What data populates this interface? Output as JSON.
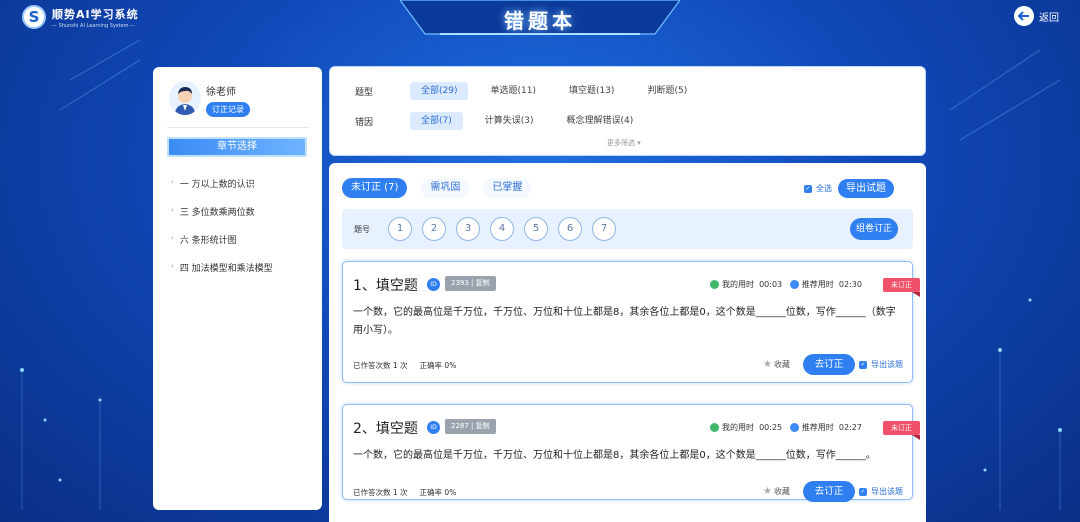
{
  "header": {
    "logo_letter": "S",
    "app_name": "顺势AI学习系统",
    "app_subtitle": "— Shunshi AI Learning System —",
    "page_title": "错题本",
    "back_label": "返回"
  },
  "teacher": {
    "name": "徐老师",
    "record_button": "订正记录"
  },
  "sidebar": {
    "chapter_button": "章节选择",
    "chapters": [
      "一 万以上数的认识",
      "三 多位数乘两位数",
      "六 条形统计图",
      "四 加法模型和乘法模型"
    ]
  },
  "filters": {
    "type_label": "题型",
    "type_options": [
      "全部(29)",
      "单选题(11)",
      "填空题(13)",
      "判断题(5)"
    ],
    "reason_label": "错因",
    "reason_options": [
      "全部(7)",
      "计算失误(3)",
      "概念理解错误(4)"
    ],
    "more_label": "更多筛选"
  },
  "main": {
    "tabs": [
      "未订正 (7)",
      "需巩固",
      "已掌握"
    ],
    "select_all": "全选",
    "export_button": "导出试题",
    "number_label": "题号",
    "numbers": [
      "1",
      "2",
      "3",
      "4",
      "5",
      "6",
      "7"
    ],
    "group_button": "组卷订正"
  },
  "questions": [
    {
      "title": "1、填空题",
      "id_badge": "ID",
      "id_tag": "2393 | 复制",
      "my_time_label": "我的用时",
      "my_time": "00:03",
      "rec_time_label": "推荐用时",
      "rec_time": "02:30",
      "status": "未订正",
      "text": "一个数，它的最高位是千万位，千万位、万位和十位上都是8，其余各位上都是0，这个数是______位数，写作______（数字用小写）。",
      "attempts": "已作答次数 1 次",
      "accuracy": "正确率 0%",
      "collect": "收藏",
      "fix_button": "去订正",
      "export": "导出该题"
    },
    {
      "title": "2、填空题",
      "id_badge": "ID",
      "id_tag": "2287 | 复制",
      "my_time_label": "我的用时",
      "my_time": "00:25",
      "rec_time_label": "推荐用时",
      "rec_time": "02:27",
      "status": "未订正",
      "text": "一个数，它的最高位是千万位，千万位、万位和十位上都是8，其余各位上都是0，这个数是______位数，写作______。",
      "attempts": "已作答次数 1 次",
      "accuracy": "正确率 0%",
      "collect": "收藏",
      "fix_button": "去订正",
      "export": "导出该题"
    }
  ],
  "colors": {
    "accent": "#2f7ff0",
    "status_red": "#f0506a",
    "background": "#1048b8"
  }
}
